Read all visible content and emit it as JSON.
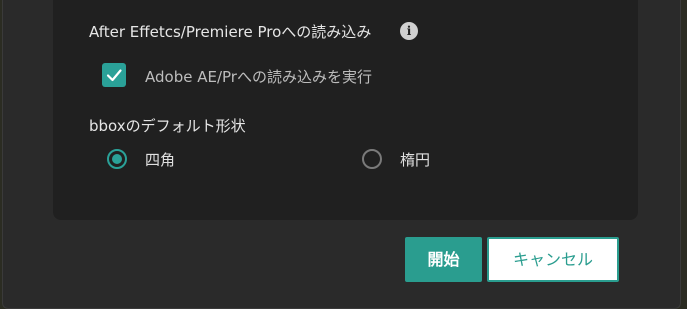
{
  "import_section": {
    "title": "After Effetcs/Premiere Proへの読み込み",
    "info_icon": "info-icon",
    "checkbox_label": "Adobe AE/Prへの読み込みを実行",
    "checkbox_checked": true
  },
  "bbox_section": {
    "title": "bboxのデフォルト形状",
    "options": [
      {
        "label": "四角",
        "selected": true
      },
      {
        "label": "楕円",
        "selected": false
      }
    ]
  },
  "buttons": {
    "start_label": "開始",
    "cancel_label": "キャンセル"
  },
  "colors": {
    "accent": "#2aa198",
    "button_primary": "#2a9d8f",
    "panel_bg": "#202020",
    "dialog_bg": "#2a2a2a"
  }
}
